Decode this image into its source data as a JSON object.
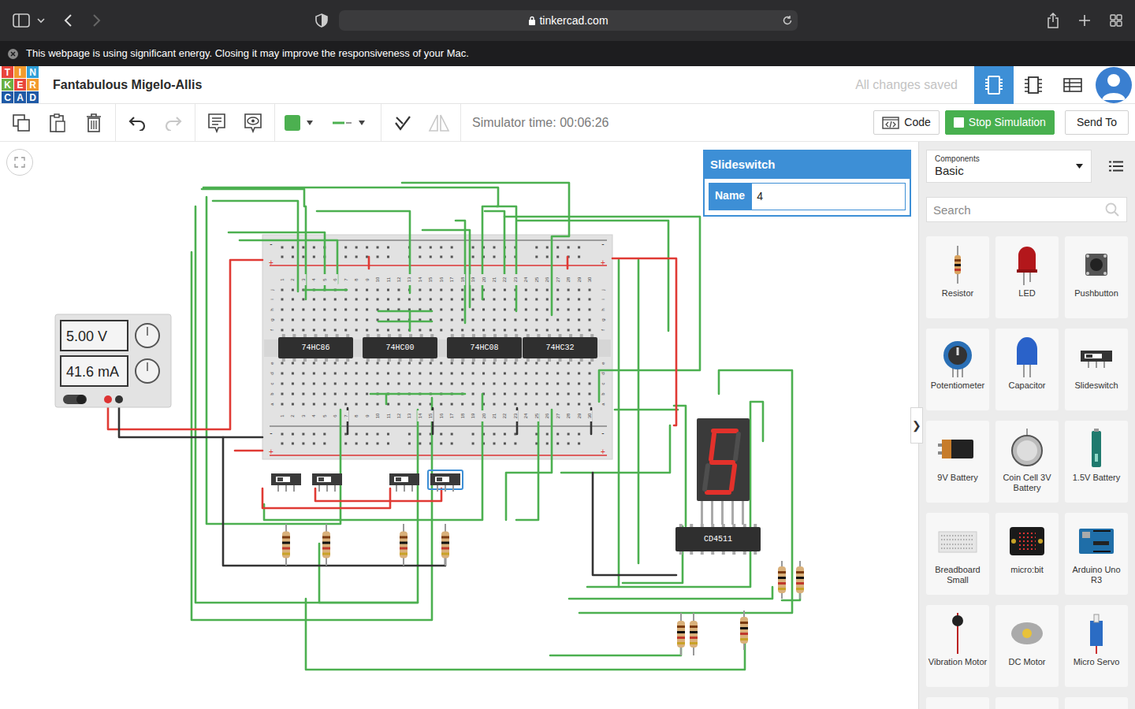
{
  "browser": {
    "url": "tinkercad.com",
    "energy_notice": "This webpage is using significant energy. Closing it may improve the responsiveness of your Mac."
  },
  "logo": [
    {
      "letter": "T",
      "color": "#e8453c"
    },
    {
      "letter": "I",
      "color": "#f29a2e"
    },
    {
      "letter": "N",
      "color": "#2f9fd8"
    },
    {
      "letter": "K",
      "color": "#6ab043"
    },
    {
      "letter": "E",
      "color": "#e8453c"
    },
    {
      "letter": "R",
      "color": "#f29a2e"
    },
    {
      "letter": "C",
      "color": "#1f5aa6"
    },
    {
      "letter": "A",
      "color": "#1f5aa6"
    },
    {
      "letter": "D",
      "color": "#1f5aa6"
    }
  ],
  "project_title": "Fantabulous Migelo-Allis",
  "save_status": "All changes saved",
  "views": [
    {
      "selected": true
    },
    {
      "selected": false
    },
    {
      "selected": false
    }
  ],
  "toolbar": {
    "wire_color": "#4cb050",
    "simulator_time": "Simulator time: 00:06:26",
    "code_button": "Code",
    "simulation_button": "Stop Simulation",
    "send_button": "Send To"
  },
  "inspector": {
    "title": "Slideswitch",
    "field_label": "Name",
    "field_value": "4"
  },
  "components_panel": {
    "label": "Components",
    "category": "Basic",
    "search_placeholder": "Search",
    "collapse_glyph": "❯",
    "items": [
      {
        "label": "Resistor",
        "kind": "resistor"
      },
      {
        "label": "LED",
        "kind": "led"
      },
      {
        "label": "Pushbutton",
        "kind": "pushbutton"
      },
      {
        "label": "Potentiometer",
        "kind": "potentiometer"
      },
      {
        "label": "Capacitor",
        "kind": "capacitor"
      },
      {
        "label": "Slideswitch",
        "kind": "slideswitch"
      },
      {
        "label": "9V Battery",
        "kind": "battery9v"
      },
      {
        "label": "Coin Cell 3V Battery",
        "kind": "coincell"
      },
      {
        "label": "1.5V Battery",
        "kind": "battery15"
      },
      {
        "label": "Breadboard Small",
        "kind": "breadboard"
      },
      {
        "label": "micro:bit",
        "kind": "microbit"
      },
      {
        "label": "Arduino Uno R3",
        "kind": "arduino"
      },
      {
        "label": "Vibration Motor",
        "kind": "vibration"
      },
      {
        "label": "DC Motor",
        "kind": "dcmotor"
      },
      {
        "label": "Micro Servo",
        "kind": "servo"
      }
    ]
  },
  "canvas": {
    "power_supply": {
      "voltage": "5.00 V",
      "current": "41.6 mA",
      "on": true
    },
    "breadboard": {
      "columns": [
        "1",
        "2",
        "3",
        "4",
        "5",
        "6",
        "7",
        "8",
        "9",
        "10",
        "11",
        "12",
        "13",
        "14",
        "15",
        "16",
        "17",
        "18",
        "19",
        "20",
        "21",
        "22",
        "23",
        "24",
        "25",
        "26",
        "27",
        "28",
        "29",
        "30"
      ],
      "rows": [
        "j",
        "i",
        "h",
        "g",
        "f",
        "e",
        "d",
        "c",
        "b",
        "a"
      ],
      "rail_minus": "-",
      "rail_plus": "+"
    },
    "breadboard_chips": [
      {
        "label": "74HC86"
      },
      {
        "label": "74HC00"
      },
      {
        "label": "74HC08"
      },
      {
        "label": "74HC32"
      }
    ],
    "decoder_chip": {
      "label": "CD4511"
    },
    "switches": [
      {
        "selected": false
      },
      {
        "selected": false
      },
      {
        "selected": false
      },
      {
        "selected": true
      }
    ],
    "display": {
      "segments": {
        "a": true,
        "b": false,
        "c": true,
        "d": true,
        "e": false,
        "f": true,
        "g": true
      }
    }
  }
}
